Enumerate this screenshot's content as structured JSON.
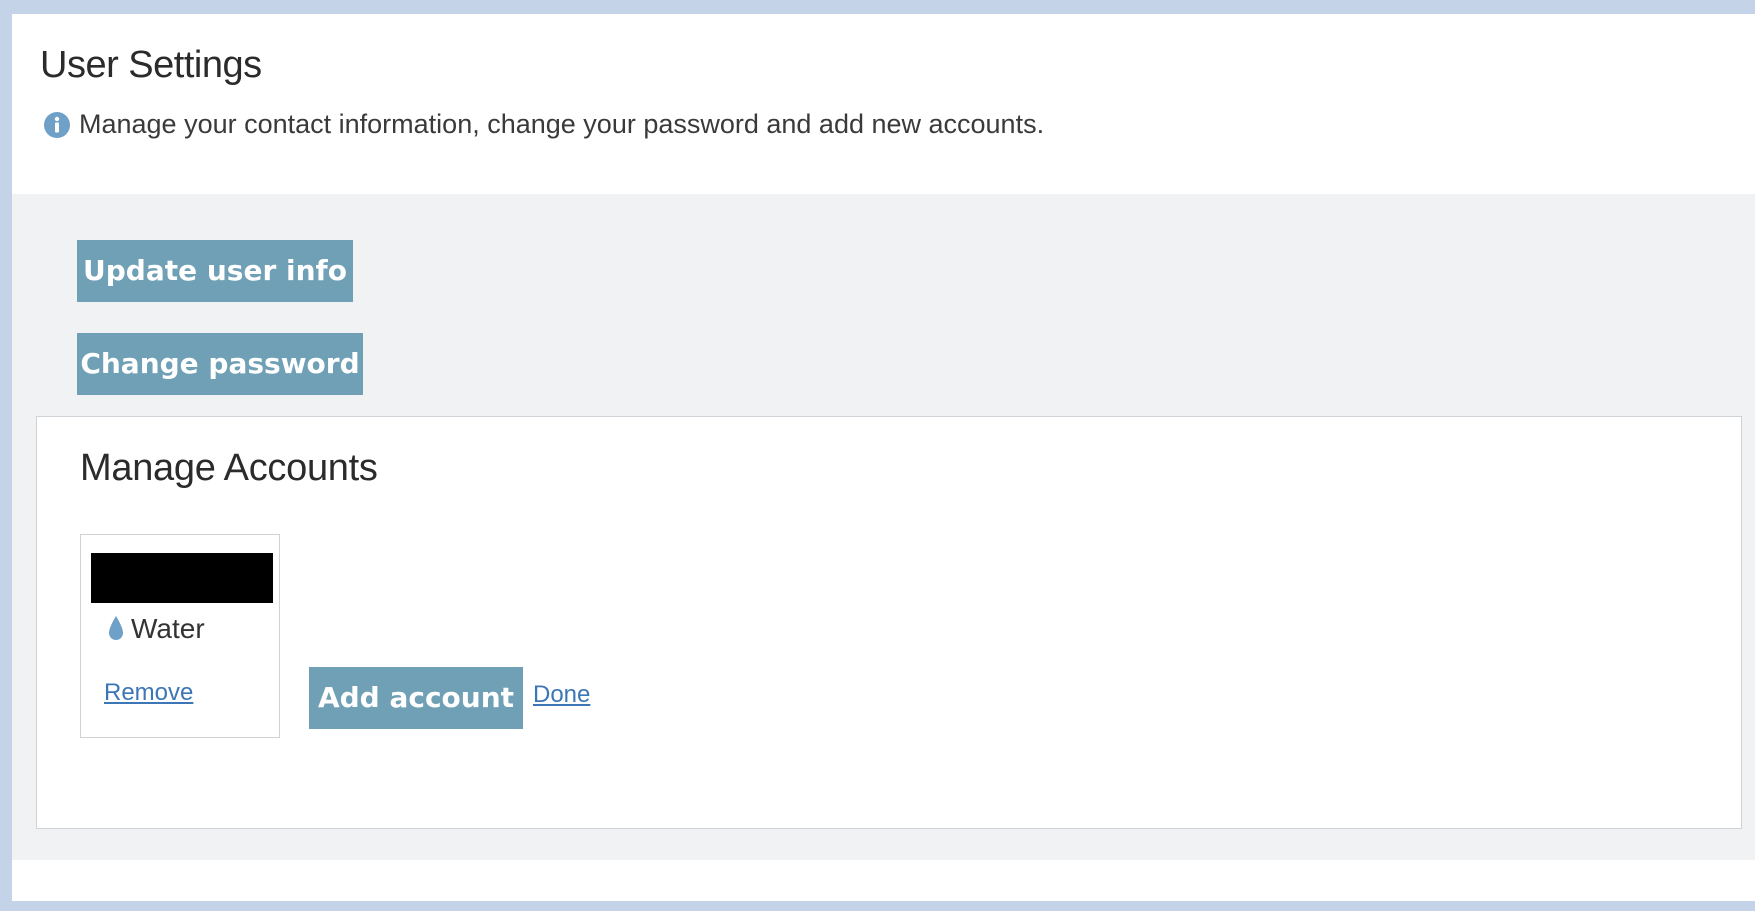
{
  "header": {
    "title": "User Settings",
    "info_icon": "info-circle-icon",
    "description": "Manage your contact information, change your password and add new accounts."
  },
  "actions": {
    "update_user_info_label": "Update user info",
    "change_password_label": "Change password"
  },
  "manage_accounts": {
    "title": "Manage Accounts",
    "accounts": [
      {
        "name": "",
        "name_redacted": true,
        "service_icon": "water-drop-icon",
        "service": "Water",
        "remove_label": "Remove"
      }
    ],
    "add_account_label": "Add account",
    "done_label": "Done"
  },
  "colors": {
    "button_bg": "#6fa0b5",
    "link": "#3d76b6",
    "accent_icon": "#6fa0c8",
    "section_bg": "#f1f2f4"
  }
}
